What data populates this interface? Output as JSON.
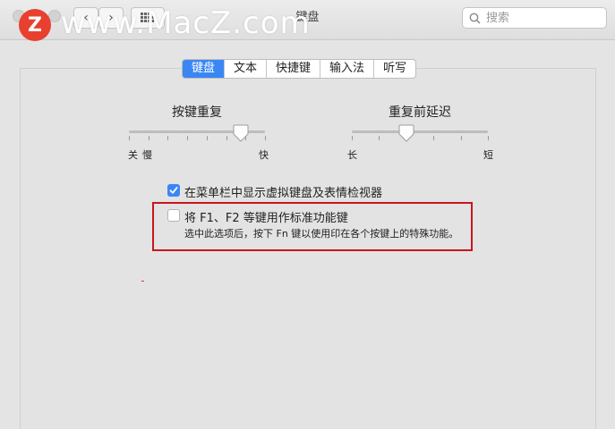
{
  "window": {
    "title": "键盘",
    "brand_badge": "Z",
    "watermark": "www.MacZ.com"
  },
  "toolbar": {
    "back_label": "‹",
    "forward_label": "›"
  },
  "search": {
    "placeholder": "搜索"
  },
  "tabs": [
    {
      "label": "键盘",
      "active": true
    },
    {
      "label": "文本",
      "active": false
    },
    {
      "label": "快捷键",
      "active": false
    },
    {
      "label": "输入法",
      "active": false
    },
    {
      "label": "听写",
      "active": false
    }
  ],
  "key_repeat": {
    "title": "按键重复",
    "left_label": "关",
    "left_label2": "慢",
    "right_label": "快",
    "value_fraction": 0.82
  },
  "delay_until_repeat": {
    "title": "重复前延迟",
    "left_label": "长",
    "right_label": "短",
    "value_fraction": 0.4
  },
  "options": {
    "show_viewer": {
      "label": "在菜单栏中显示虚拟键盘及表情检视器",
      "checked": true
    },
    "fn_keys": {
      "label": "将 F1、F2 等键用作标准功能键",
      "checked": false,
      "description": "选中此选项后，按下 Fn 键以使用印在各个按键上的特殊功能。"
    }
  },
  "colors": {
    "accent": "#3a87f3",
    "highlight_border": "#c8161d",
    "brand": "#e8402f"
  }
}
